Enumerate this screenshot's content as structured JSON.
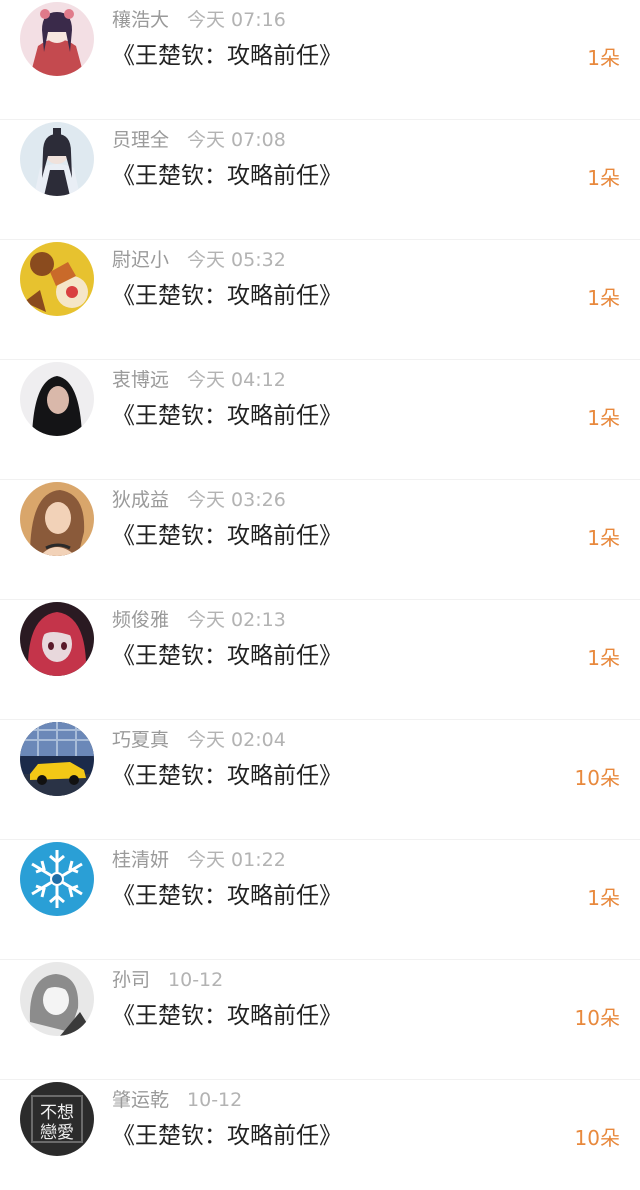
{
  "rows": [
    {
      "name": "穰浩大",
      "time": "今天 07:16",
      "title": "《王楚钦：攻略前任》",
      "gift": "1朵",
      "avatar": "anime-girl-red-kimono",
      "colors": [
        "#f3dfe4",
        "#c44a4f",
        "#3a2a4a"
      ]
    },
    {
      "name": "员理全",
      "time": "今天 07:08",
      "title": "《王楚钦：攻略前任》",
      "gift": "1朵",
      "avatar": "ancient-style-girl",
      "colors": [
        "#dfe9f0",
        "#2c2c38",
        "#f0e2dc"
      ]
    },
    {
      "name": "尉迟小",
      "time": "今天 05:32",
      "title": "《王楚钦：攻略前任》",
      "gift": "1朵",
      "avatar": "game-character-yellow",
      "colors": [
        "#e7c22f",
        "#8a4b1e",
        "#f5e6c8"
      ]
    },
    {
      "name": "衷博远",
      "time": "今天 04:12",
      "title": "《王楚钦：攻略前任》",
      "gift": "1朵",
      "avatar": "dark-hair-woman",
      "colors": [
        "#efeef0",
        "#141416",
        "#d9b8aa"
      ]
    },
    {
      "name": "狄成益",
      "time": "今天 03:26",
      "title": "《王楚钦：攻略前任》",
      "gift": "1朵",
      "avatar": "woman-portrait-warm",
      "colors": [
        "#d9a66b",
        "#8a5a3a",
        "#f2d2b8"
      ]
    },
    {
      "name": "频俊雅",
      "time": "今天 02:13",
      "title": "《王楚钦：攻略前任》",
      "gift": "1朵",
      "avatar": "anime-red-dark",
      "colors": [
        "#2a1a22",
        "#c4344a",
        "#e8d8dc"
      ]
    },
    {
      "name": "巧夏真",
      "time": "今天 02:04",
      "title": "《王楚钦：攻略前任》",
      "gift": "10朵",
      "avatar": "yellow-sports-car",
      "colors": [
        "#1b2a4a",
        "#f3c816",
        "#6b88b8"
      ]
    },
    {
      "name": "桂清妍",
      "time": "今天 01:22",
      "title": "《王楚钦：攻略前任》",
      "gift": "1朵",
      "avatar": "blue-snowflake",
      "colors": [
        "#2a9fd6",
        "#ffffff",
        "#1f6fa8"
      ]
    },
    {
      "name": "孙司",
      "time": "10-12",
      "title": "《王楚钦：攻略前任》",
      "gift": "10朵",
      "avatar": "grayscale-anime",
      "colors": [
        "#e8e8e8",
        "#8c8c8c",
        "#3a3a3a"
      ]
    },
    {
      "name": "肇运乾",
      "time": "10-12",
      "title": "《王楚钦：攻略前任》",
      "gift": "10朵",
      "avatar": "calligraphy-bu-xiang-lian-ai",
      "avatar_text": [
        "不想",
        "戀愛"
      ],
      "colors": [
        "#2b2b2b",
        "#f0f0f0",
        "#6a6a6a"
      ]
    }
  ]
}
